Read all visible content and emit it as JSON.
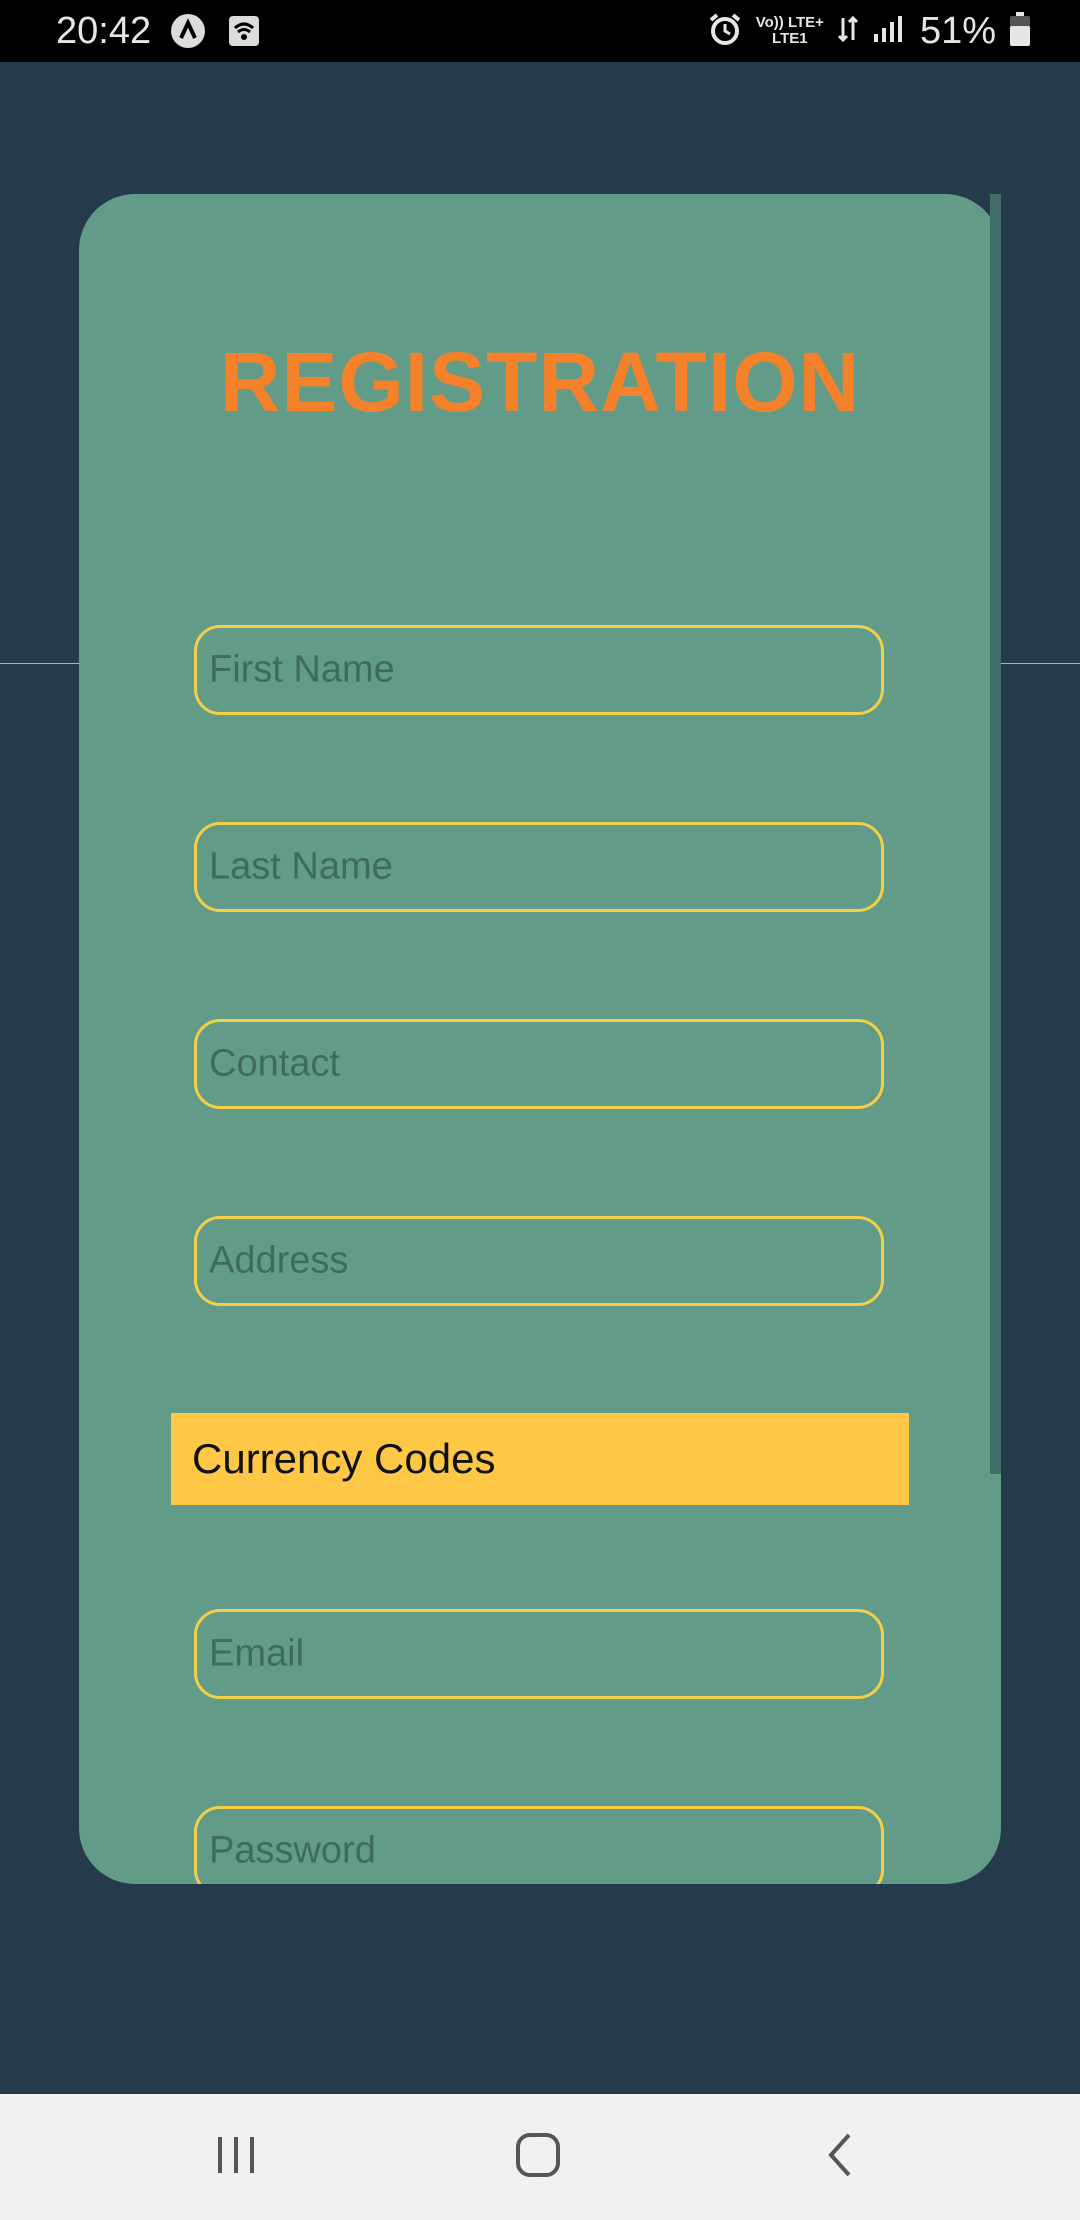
{
  "status_bar": {
    "time": "20:42",
    "battery_percent": "51%",
    "lte_top": "Vo)) LTE+",
    "lte_bottom": "LTE1",
    "icons": [
      "notification-a-icon",
      "wifi-hotspot-icon",
      "alarm-icon",
      "data-arrows-icon",
      "signal-icon",
      "battery-icon"
    ]
  },
  "form": {
    "title": "REGISTRATION",
    "fields": [
      {
        "placeholder": "First Name"
      },
      {
        "placeholder": "Last Name"
      },
      {
        "placeholder": "Contact"
      },
      {
        "placeholder": "Address"
      }
    ],
    "currency_label": "Currency Codes",
    "fields_after": [
      {
        "placeholder": "Email"
      },
      {
        "placeholder": "Password"
      }
    ]
  },
  "colors": {
    "background": "#253a4b",
    "card": "#629c88",
    "title": "#f5822a",
    "field_border": "#f2cf49",
    "currency_bg": "#fec846",
    "placeholder": "#3e6b5d"
  },
  "nav_bar": {
    "icons": [
      "recent-apps-icon",
      "home-icon",
      "back-icon"
    ]
  }
}
